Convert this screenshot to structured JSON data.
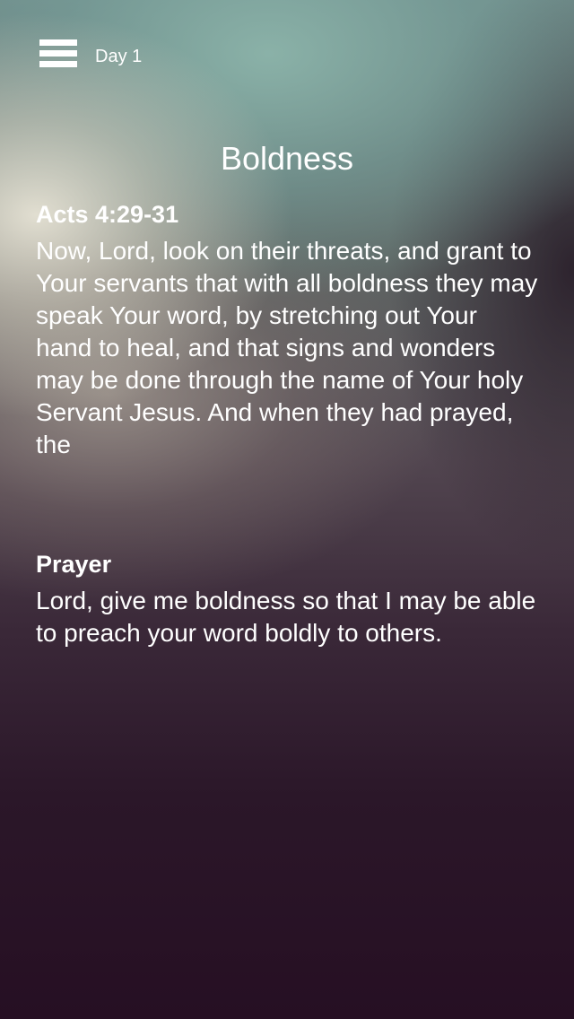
{
  "header": {
    "menu_icon": "hamburger-menu-icon",
    "day_label": "Day 1"
  },
  "page": {
    "title": "Boldness"
  },
  "scripture": {
    "reference": "Acts 4:29-31",
    "text": "Now, Lord, look on their threats, and grant to Your servants that with all boldness they may speak Your word, by stretching out Your hand to heal, and that signs and wonders may be done through the name of Your holy Servant Jesus. And when they had prayed, the"
  },
  "prayer": {
    "heading": "Prayer",
    "text": "Lord, give me boldness so that I may be able to preach your word boldly to others."
  },
  "colors": {
    "text": "#ffffff",
    "background_bottom": "#260f23"
  }
}
